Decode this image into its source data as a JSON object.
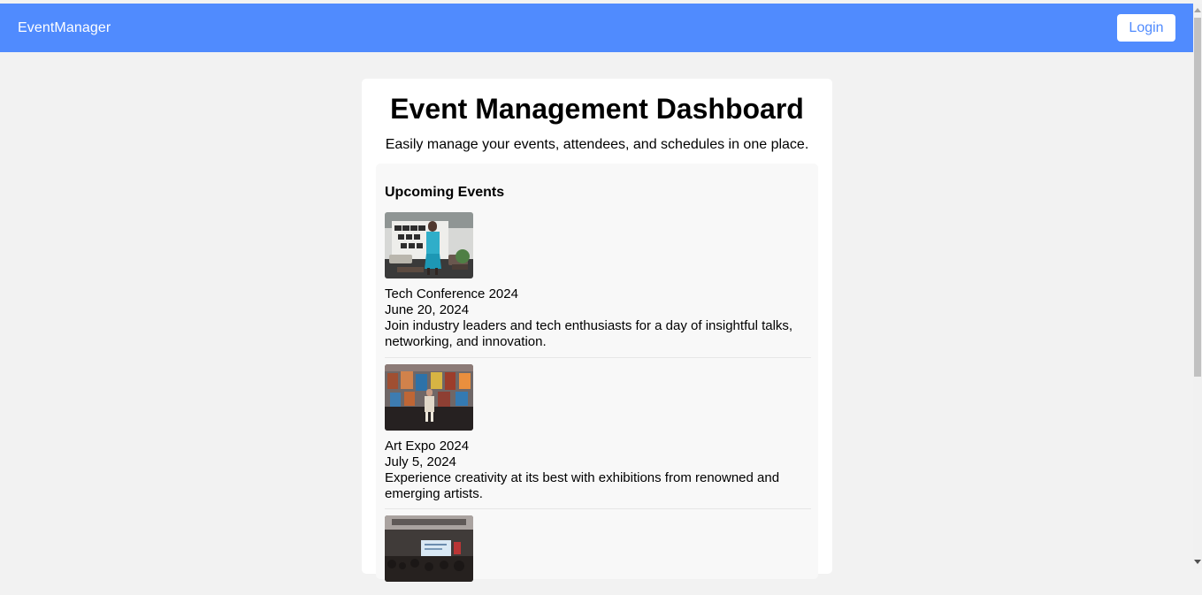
{
  "header": {
    "brand": "EventManager",
    "login_label": "Login"
  },
  "main": {
    "title": "Event Management Dashboard",
    "subtitle": "Easily manage your events, attendees, and schedules in one place."
  },
  "events": {
    "heading": "Upcoming Events",
    "items": [
      {
        "title": "Tech Conference 2024",
        "date": "June 20, 2024",
        "description": "Join industry leaders and tech enthusiasts for a day of insightful talks, networking, and innovation."
      },
      {
        "title": "Art Expo 2024",
        "date": "July 5, 2024",
        "description": "Experience creativity at its best with exhibitions from renowned and emerging artists."
      },
      {
        "title": "",
        "date": "",
        "description": ""
      }
    ]
  },
  "colors": {
    "header_bg": "#508bfe",
    "page_bg": "#f2f2f2",
    "card_bg": "#ffffff",
    "panel_bg": "#f8f8f8"
  },
  "icons": {
    "scroll_up": "scroll-up-arrow-icon",
    "scroll_down": "scroll-down-arrow-icon"
  }
}
